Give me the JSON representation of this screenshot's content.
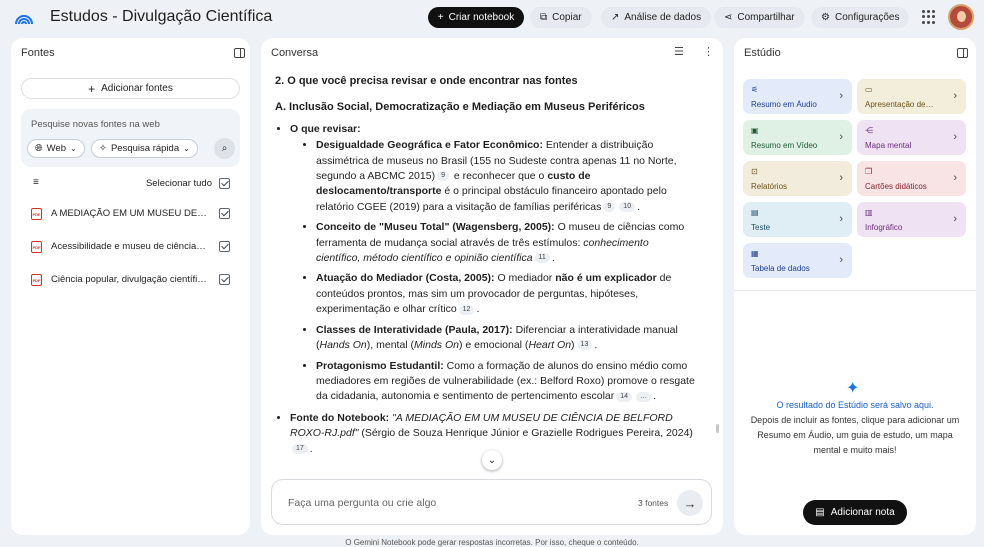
{
  "app": {
    "title": "Estudos - Divulgação Científica"
  },
  "toolbar": {
    "create_notebook": "Criar notebook",
    "copy": "Copiar",
    "analytics": "Análise de dados",
    "share": "Compartilhar",
    "settings": "Configurações"
  },
  "sources": {
    "header": "Fontes",
    "add_label": "Adicionar fontes",
    "search_placeholder": "Pesquise novas fontes na web",
    "web_chip": "Web",
    "mode_chip": "Pesquisa rápida",
    "select_all": "Selecionar tudo",
    "items": [
      {
        "name": "A MEDIAÇÃO EM UM MUSEU DE CIÊNCIA DE BELFORD ROXO-RJ.pdf"
      },
      {
        "name": "Acessibilidade e museu de ciência…"
      },
      {
        "name": "Ciência popular, divulgação científica…"
      }
    ]
  },
  "chat": {
    "header": "Conversa",
    "heading": "2. O que você precisa revisar e onde encontrar nas fontes",
    "subheading": "A. Inclusão Social, Democratização e Mediação em Museus Periféricos",
    "review_label": "O que revisar:",
    "items": [
      {
        "bold": "Desigualdade Geográfica e Fator Econômico:",
        "t1": " Entender a distribuição assimétrica de museus no Brasil (155 no Sudeste contra apenas 11 no Norte, segundo a ABCMC 2015)",
        "c1": "9",
        "t2": " e reconhecer que o ",
        "bold2": "custo de deslocamento/transporte",
        "t3": " é o principal obstáculo financeiro apontado pelo relatório CGEE (2019) para a visitação de famílias periféricas",
        "c2": "9",
        "c3": "10",
        "t4": "."
      },
      {
        "bold": "Conceito de \"Museu Total\" (Wagensberg, 2005):",
        "t1": " O museu de ciências como ferramenta de mudança social através de três estímulos: ",
        "i1": "conhecimento científico, método científico e opinião científica",
        "c1": "11",
        "t2": "."
      },
      {
        "bold": "Atuação do Mediador (Costa, 2005):",
        "t1": " O mediador ",
        "bold2": "não é um explicador",
        "t2": " de conteúdos prontos, mas sim um provocador de perguntas, hipóteses, experimentação e olhar crítico",
        "c1": "12",
        "t3": "."
      },
      {
        "bold": "Classes de Interatividade (Paula, 2017):",
        "t1": " Diferenciar a interatividade manual (",
        "i1": "Hands On",
        "t2": "), mental (",
        "i2": "Minds On",
        "t3": ") e emocional (",
        "i3": "Heart On",
        "t4": ")",
        "c1": "13",
        "t5": "."
      },
      {
        "bold": "Protagonismo Estudantil:",
        "t1": " Como a formação de alunos do ensino médio como mediadores em regiões de vulnerabilidade (ex.: Belford Roxo) promove o resgate da cidadania, autonomia e sentimento de pertencimento escolar",
        "c1": "14",
        "c2": "…",
        "t2": "."
      }
    ],
    "source_note": {
      "bold": "Fonte do Notebook:",
      "i1": " \"A MEDIAÇÃO EM UM MUSEU DE CIÊNCIA DE BELFORD ROXO-RJ.pdf\"",
      "t1": " (Sérgio de Souza Henrique Júnior e Grazielle Rodrigues Pereira, 2024)",
      "c1": "17",
      "t2": "."
    },
    "input_placeholder": "Faça uma pergunta ou crie algo",
    "source_count": "3 fontes",
    "disclaimer": "O Gemini Notebook pode gerar respostas incorretas. Por isso, cheque o conteúdo."
  },
  "studio": {
    "header": "Estúdio",
    "tiles": [
      {
        "label": "Resumo em Áudio",
        "color": "#e3ebfb",
        "text": "#1d3f8f",
        "icon": "audio-icon"
      },
      {
        "label": "Apresentação de…",
        "color": "#f3eddc",
        "text": "#6b5416",
        "icon": "slides-icon"
      },
      {
        "label": "Resumo em Vídeo",
        "color": "#dff0e4",
        "text": "#1d5c33",
        "icon": "video-icon"
      },
      {
        "label": "Mapa mental",
        "color": "#efe3f3",
        "text": "#6a2d7d",
        "icon": "mindmap-icon"
      },
      {
        "label": "Relatórios",
        "color": "#f2ecdd",
        "text": "#6b5416",
        "icon": "report-icon"
      },
      {
        "label": "Cartões didáticos",
        "color": "#f8e3e5",
        "text": "#8a2430",
        "icon": "flashcards-icon"
      },
      {
        "label": "Teste",
        "color": "#dfeef5",
        "text": "#1f4f68",
        "icon": "quiz-icon"
      },
      {
        "label": "Infográfico",
        "color": "#efe3f3",
        "text": "#6a2d7d",
        "icon": "infographic-icon"
      },
      {
        "label": "Tabela de dados",
        "color": "#e3ebfb",
        "text": "#1d3f8f",
        "icon": "table-icon"
      }
    ],
    "empty_title": "O resultado do Estúdio será salvo aqui.",
    "empty_body": "Depois de incluir as fontes, clique para adicionar um Resumo em Áudio, um guia de estudo, um mapa mental e muito mais!",
    "add_note": "Adicionar nota"
  }
}
